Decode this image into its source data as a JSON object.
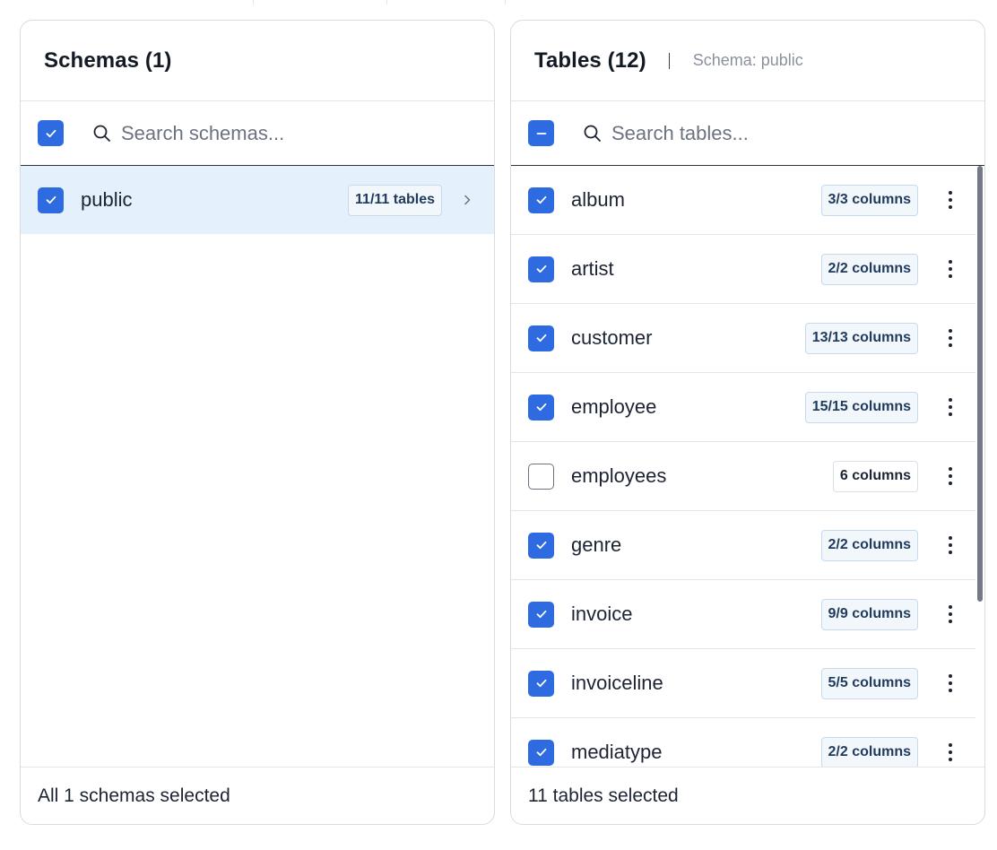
{
  "colors": {
    "accent": "#2f6be0",
    "selected_row_bg": "#e4f0fb",
    "badge_bg": "#f2f7fc",
    "badge_text": "#1f3a5c"
  },
  "schemas_panel": {
    "title": "Schemas (1)",
    "search_placeholder": "Search schemas...",
    "select_all_state": "checked",
    "items": [
      {
        "label": "public",
        "badge": "11/11 tables",
        "checked": true,
        "selected": true
      }
    ],
    "footer": "All 1 schemas selected"
  },
  "tables_panel": {
    "title": "Tables (12)",
    "subtitle": "Schema: public",
    "search_placeholder": "Search tables...",
    "select_all_state": "indeterminate",
    "items": [
      {
        "label": "album",
        "badge": "3/3 columns",
        "checked": true
      },
      {
        "label": "artist",
        "badge": "2/2 columns",
        "checked": true
      },
      {
        "label": "customer",
        "badge": "13/13 columns",
        "checked": true
      },
      {
        "label": "employee",
        "badge": "15/15 columns",
        "checked": true
      },
      {
        "label": "employees",
        "badge": "6 columns",
        "checked": false
      },
      {
        "label": "genre",
        "badge": "2/2 columns",
        "checked": true
      },
      {
        "label": "invoice",
        "badge": "9/9 columns",
        "checked": true
      },
      {
        "label": "invoiceline",
        "badge": "5/5 columns",
        "checked": true
      },
      {
        "label": "mediatype",
        "badge": "2/2 columns",
        "checked": true
      }
    ],
    "scroll_position": 0,
    "footer": "11 tables selected"
  }
}
